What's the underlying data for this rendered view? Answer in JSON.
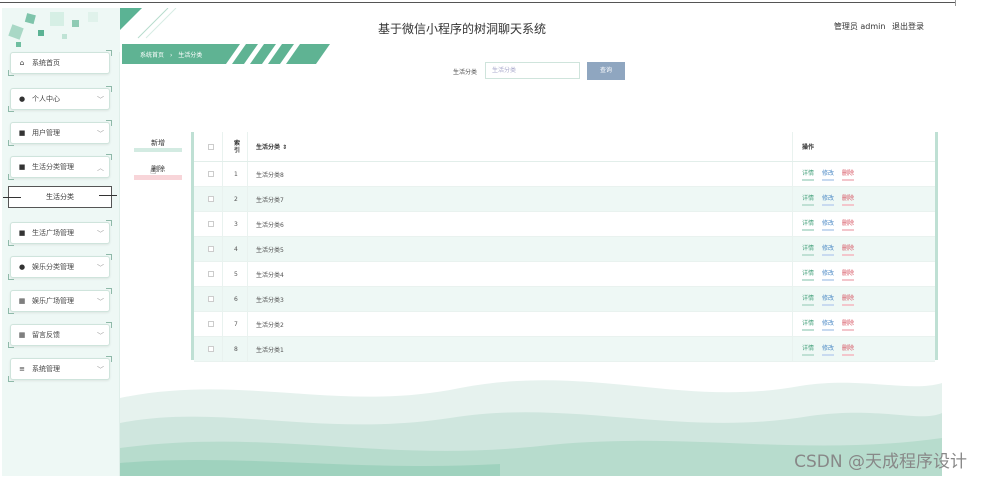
{
  "header": {
    "title": "基于微信小程序的树洞聊天系统",
    "user_label": "管理员 admin",
    "logout_label": "退出登录"
  },
  "breadcrumb": {
    "home": "系统首页",
    "separator": "›",
    "current": "生活分类"
  },
  "sidebar": {
    "items": [
      {
        "label": "系统首页",
        "icon": "home-icon",
        "glyph": "⌂"
      },
      {
        "label": "个人中心",
        "icon": "user-icon",
        "glyph": "●"
      },
      {
        "label": "用户管理",
        "icon": "monitor-icon",
        "glyph": "■"
      },
      {
        "label": "生活分类管理",
        "icon": "monitor-icon",
        "glyph": "■"
      },
      {
        "label": "生活广场管理",
        "icon": "lock-icon",
        "glyph": "■"
      },
      {
        "label": "娱乐分类管理",
        "icon": "pin-icon",
        "glyph": "●"
      },
      {
        "label": "娱乐广场管理",
        "icon": "grid-icon",
        "glyph": "▦"
      },
      {
        "label": "留言反馈",
        "icon": "grid-icon",
        "glyph": "▦"
      },
      {
        "label": "系统管理",
        "icon": "settings-icon",
        "glyph": "≡"
      }
    ],
    "submenu_active": "生活分类"
  },
  "search": {
    "label": "生活分类",
    "placeholder": "生活分类",
    "button": "查询"
  },
  "actions": {
    "add": "新增",
    "delete": "删除"
  },
  "table": {
    "headers": {
      "index": "索引",
      "name": "生活分类 ⇕",
      "ops": "操作"
    },
    "rows": [
      {
        "index": "1",
        "name": "生活分类8"
      },
      {
        "index": "2",
        "name": "生活分类7"
      },
      {
        "index": "3",
        "name": "生活分类6"
      },
      {
        "index": "4",
        "name": "生活分类5"
      },
      {
        "index": "5",
        "name": "生活分类4"
      },
      {
        "index": "6",
        "name": "生活分类3"
      },
      {
        "index": "7",
        "name": "生活分类2"
      },
      {
        "index": "8",
        "name": "生活分类1"
      }
    ],
    "op_labels": {
      "detail": "详情",
      "edit": "修改",
      "delete": "删除"
    }
  },
  "watermark": "CSDN @天成程序设计",
  "colors": {
    "accent": "#4aa37f",
    "edit": "#4d8ac5",
    "danger": "#d6505e",
    "search_btn": "#8fa6c0"
  }
}
